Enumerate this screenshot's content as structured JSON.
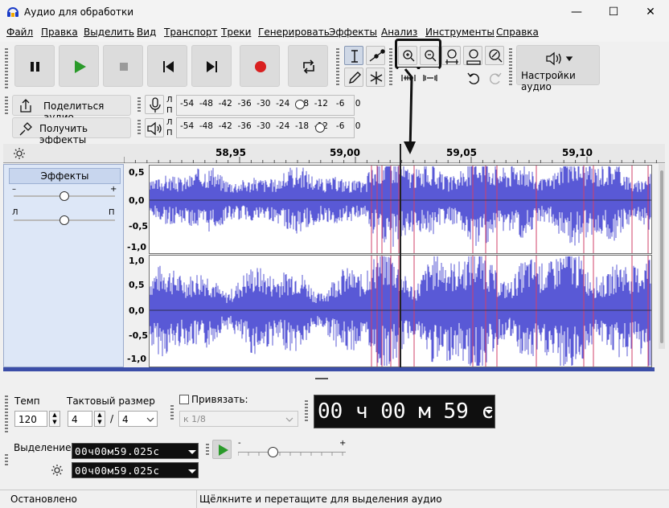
{
  "window": {
    "title": "Аудио для обработки",
    "minimize": "—",
    "maximize": "☐",
    "close": "✕"
  },
  "menu": [
    "Файл",
    "Правка",
    "Выделить",
    "Вид",
    "Транспорт",
    "Треки",
    "Генерировать",
    "Эффекты",
    "Анализ",
    "Инструменты",
    "Справка"
  ],
  "toolbar": {
    "audio_settings_label": "Настройки аудио",
    "share_label": "Поделиться аудио",
    "get_effects_label": "Получить эффекты"
  },
  "meters": {
    "rec_channels": "Л\nП",
    "rec_scale": "-54  -48  -42  -36  -30  -24  -18  -12   -6    0",
    "play_scale": "-54  -48  -42  -36  -30  -24  -18  -12   -6    0"
  },
  "ruler": {
    "labels": [
      "58,95",
      "59,00",
      "59,05",
      "59,10"
    ]
  },
  "track": {
    "effects_label": "Эффекты",
    "gain_minus": "–",
    "gain_plus": "+",
    "pan_left": "Л",
    "pan_right": "П",
    "y_labels_top": [
      "0,5",
      "0,0",
      "-0,5",
      "-1,0"
    ],
    "y_labels_bottom": [
      "1,0",
      "0,5",
      "0,0",
      "-0,5",
      "-1,0"
    ]
  },
  "bottom": {
    "tempo_label": "Темп",
    "tempo_value": "120",
    "meter_label": "Тактовый размер",
    "meter_num": "4",
    "meter_slash": "/",
    "meter_den": "4",
    "snap_label": "Привязать:",
    "snap_value": "к 1/8",
    "time_display": "00 ч 00 м 59 с",
    "selection_label": "Выделение",
    "sel_start": "00ч00м59.025с",
    "sel_end": "00ч00м59.025с",
    "speed_minus": "-",
    "speed_plus": "+"
  },
  "status": {
    "left": "Остановлено",
    "right": "Щёлкните и перетащите для выделения аудио"
  },
  "colors": {
    "wave": "#5959d6",
    "selection_line": "#d1406a",
    "accent_red": "#d92020",
    "play_green": "#2a9a2a"
  }
}
